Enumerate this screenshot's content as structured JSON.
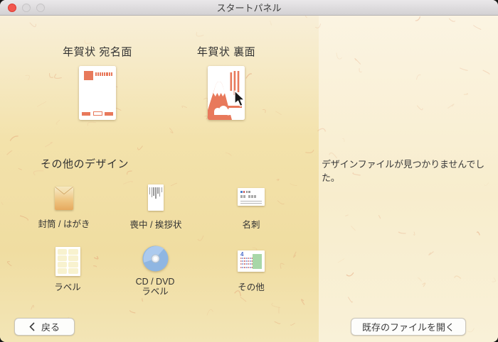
{
  "window": {
    "title": "スタートパネル"
  },
  "main": {
    "nenga_front": {
      "label": "年賀状 宛名面"
    },
    "nenga_back": {
      "label": "年賀状 裏面"
    },
    "other_heading": "その他のデザイン",
    "other_items": [
      {
        "label": "封筒 / はがき",
        "icon": "envelope-icon"
      },
      {
        "label": "喪中 / 挨拶状",
        "icon": "mourning-card-icon"
      },
      {
        "label": "名刺",
        "icon": "business-card-icon"
      },
      {
        "label": "ラベル",
        "icon": "label-sheet-icon"
      },
      {
        "label": "CD / DVD",
        "label2": "ラベル",
        "icon": "cd-dvd-icon"
      },
      {
        "label": "その他",
        "icon": "misc-card-icon"
      }
    ]
  },
  "right_panel": {
    "empty_message": "デザインファイルが見つかりませんでした。"
  },
  "footer": {
    "back_label": "戻る",
    "open_label": "既存のファイルを開く"
  },
  "colors": {
    "accent_salmon": "#e8795b",
    "left_panel_gold": "#f2e0a8",
    "right_panel_cream": "#f8edcd",
    "cd_blue": "#8fb6e2",
    "label_green": "#a8d7a8",
    "close_red": "#f2574e"
  }
}
